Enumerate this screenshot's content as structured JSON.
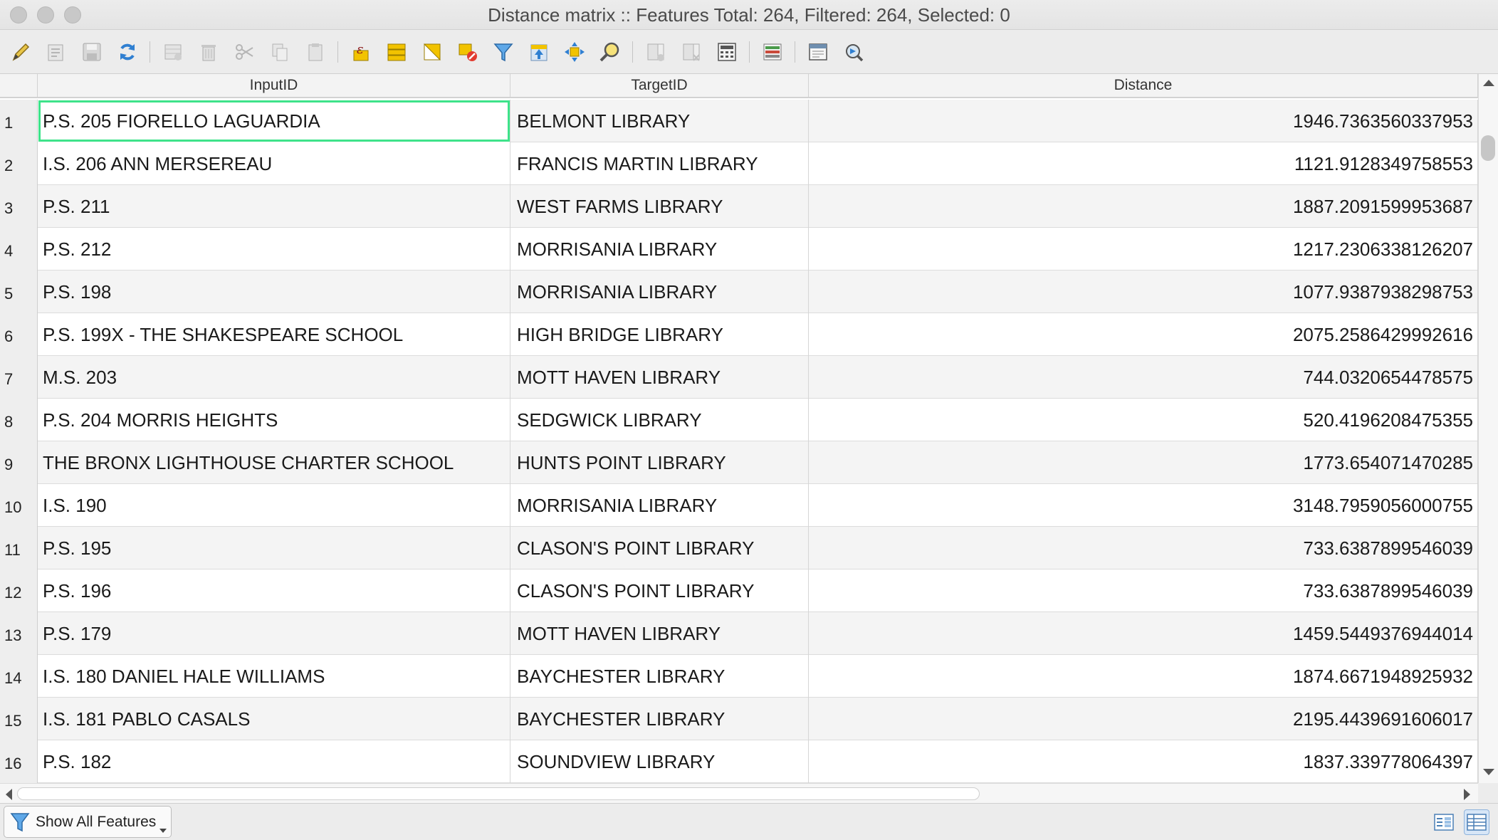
{
  "window": {
    "title": "Distance matrix :: Features Total: 264, Filtered: 264, Selected: 0"
  },
  "toolbar": {
    "buttons": [
      "toggle-editing-icon",
      "multi-edit-icon",
      "save-edits-icon",
      "reload-table-icon",
      "add-feature-icon",
      "delete-feature-icon",
      "cut-icon",
      "copy-icon",
      "paste-icon",
      "select-by-expression-icon",
      "select-all-icon",
      "invert-selection-icon",
      "deselect-all-icon",
      "filter-select-icon",
      "move-selection-to-top-icon",
      "pan-to-selected-icon",
      "zoom-to-selected-icon",
      "new-field-icon",
      "delete-field-icon",
      "field-calculator-icon",
      "conditional-formatting-icon",
      "actions-icon",
      "dock-table-icon"
    ]
  },
  "table": {
    "columns": [
      "InputID",
      "TargetID",
      "Distance"
    ],
    "rows": [
      {
        "n": "1",
        "input": "P.S. 205 FIORELLO LAGUARDIA",
        "target": "BELMONT LIBRARY",
        "distance": "1946.7363560337953"
      },
      {
        "n": "2",
        "input": "I.S. 206 ANN MERSEREAU",
        "target": "FRANCIS MARTIN LIBRARY",
        "distance": "1121.9128349758553"
      },
      {
        "n": "3",
        "input": "P.S. 211",
        "target": "WEST FARMS LIBRARY",
        "distance": "1887.2091599953687"
      },
      {
        "n": "4",
        "input": "P.S. 212",
        "target": "MORRISANIA LIBRARY",
        "distance": "1217.2306338126207"
      },
      {
        "n": "5",
        "input": "P.S. 198",
        "target": "MORRISANIA LIBRARY",
        "distance": "1077.9387938298753"
      },
      {
        "n": "6",
        "input": "P.S. 199X - THE SHAKESPEARE SCHOOL",
        "target": "HIGH BRIDGE LIBRARY",
        "distance": "2075.2586429992616"
      },
      {
        "n": "7",
        "input": "M.S. 203",
        "target": "MOTT HAVEN LIBRARY",
        "distance": "744.0320654478575"
      },
      {
        "n": "8",
        "input": "P.S. 204 MORRIS HEIGHTS",
        "target": "SEDGWICK LIBRARY",
        "distance": "520.4196208475355"
      },
      {
        "n": "9",
        "input": "THE BRONX LIGHTHOUSE CHARTER SCHOOL",
        "target": "HUNTS POINT LIBRARY",
        "distance": "1773.654071470285"
      },
      {
        "n": "10",
        "input": "I.S. 190",
        "target": "MORRISANIA LIBRARY",
        "distance": "3148.7959056000755"
      },
      {
        "n": "11",
        "input": "P.S. 195",
        "target": "CLASON'S POINT LIBRARY",
        "distance": "733.6387899546039"
      },
      {
        "n": "12",
        "input": "P.S. 196",
        "target": "CLASON'S POINT LIBRARY",
        "distance": "733.6387899546039"
      },
      {
        "n": "13",
        "input": "P.S. 179",
        "target": "MOTT HAVEN LIBRARY",
        "distance": "1459.5449376944014"
      },
      {
        "n": "14",
        "input": "I.S. 180 DANIEL HALE WILLIAMS",
        "target": "BAYCHESTER LIBRARY",
        "distance": "1874.6671948925932"
      },
      {
        "n": "15",
        "input": "I.S. 181 PABLO CASALS",
        "target": "BAYCHESTER LIBRARY",
        "distance": "2195.4439691606017"
      },
      {
        "n": "16",
        "input": "P.S. 182",
        "target": "SOUNDVIEW LIBRARY",
        "distance": "1837.339778064397"
      }
    ]
  },
  "bottombar": {
    "show_all_label": "Show All Features"
  },
  "colors": {
    "selection_outline": "#3ee38a",
    "alt_row": "#f4f4f4"
  }
}
